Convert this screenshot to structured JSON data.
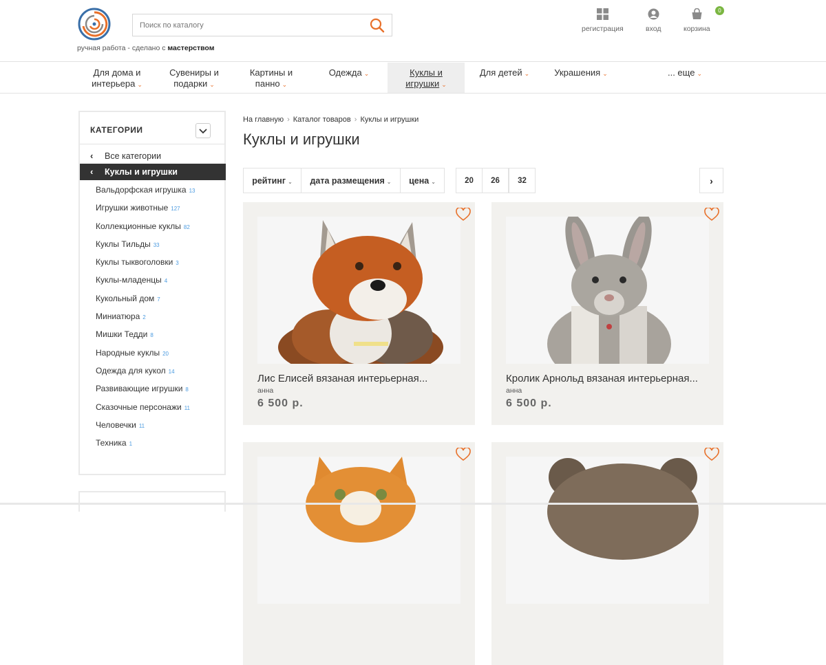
{
  "header": {
    "tagline_prefix": "ручная работа - сделано с",
    "tagline_bold": "мастерством",
    "search_placeholder": "Поиск по каталогу",
    "register_label": "регистрация",
    "login_label": "вход",
    "cart_label": "корзина",
    "cart_count": "0"
  },
  "nav": [
    {
      "line1": "Для дома и",
      "line2": "интерьера"
    },
    {
      "line1": "Сувениры и",
      "line2": "подарки"
    },
    {
      "line1": "Картины и",
      "line2": "панно"
    },
    {
      "line1": "Одежда",
      "line2": ""
    },
    {
      "line1": "Куклы и",
      "line2": "игрушки"
    },
    {
      "line1": "Для детей",
      "line2": ""
    },
    {
      "line1": "Украшения",
      "line2": ""
    },
    {
      "line1": "... еще",
      "line2": ""
    }
  ],
  "sidebar": {
    "title": "КАТЕГОРИИ",
    "all_label": "Все категории",
    "active_label": "Куклы и игрушки",
    "items": [
      {
        "label": "Вальдорфская игрушка",
        "count": "13"
      },
      {
        "label": "Игрушки животные",
        "count": "127"
      },
      {
        "label": "Коллекционные куклы",
        "count": "82"
      },
      {
        "label": "Куклы Тильды",
        "count": "33"
      },
      {
        "label": "Куклы тыквоголовки",
        "count": "3"
      },
      {
        "label": "Куклы-младенцы",
        "count": "4"
      },
      {
        "label": "Кукольный дом",
        "count": "7"
      },
      {
        "label": "Миниатюра",
        "count": "2"
      },
      {
        "label": "Мишки Тедди",
        "count": "8"
      },
      {
        "label": "Народные куклы",
        "count": "20"
      },
      {
        "label": "Одежда для кукол",
        "count": "14"
      },
      {
        "label": "Развивающие игрушки",
        "count": "8"
      },
      {
        "label": "Сказочные персонажи",
        "count": "11"
      },
      {
        "label": "Человечки",
        "count": "11"
      },
      {
        "label": "Техника",
        "count": "1"
      }
    ]
  },
  "breadcrumb": [
    "На главную",
    "Каталог товаров",
    "Куклы и игрушки"
  ],
  "page_title": "Куклы и игрушки",
  "sort": {
    "rating": "рейтинг",
    "date": "дата размещения",
    "price": "цена"
  },
  "per_page": [
    "20",
    "26",
    "32"
  ],
  "products": [
    {
      "name": "Лис Елисей вязаная интерьерная...",
      "author": "анна",
      "price": "6 500 р."
    },
    {
      "name": "Кролик Арнольд вязаная интерьерная...",
      "author": "анна",
      "price": "6 500 р."
    }
  ],
  "colors": {
    "accent": "#e8702a",
    "badge": "#7bb642",
    "count": "#4c9be0"
  }
}
